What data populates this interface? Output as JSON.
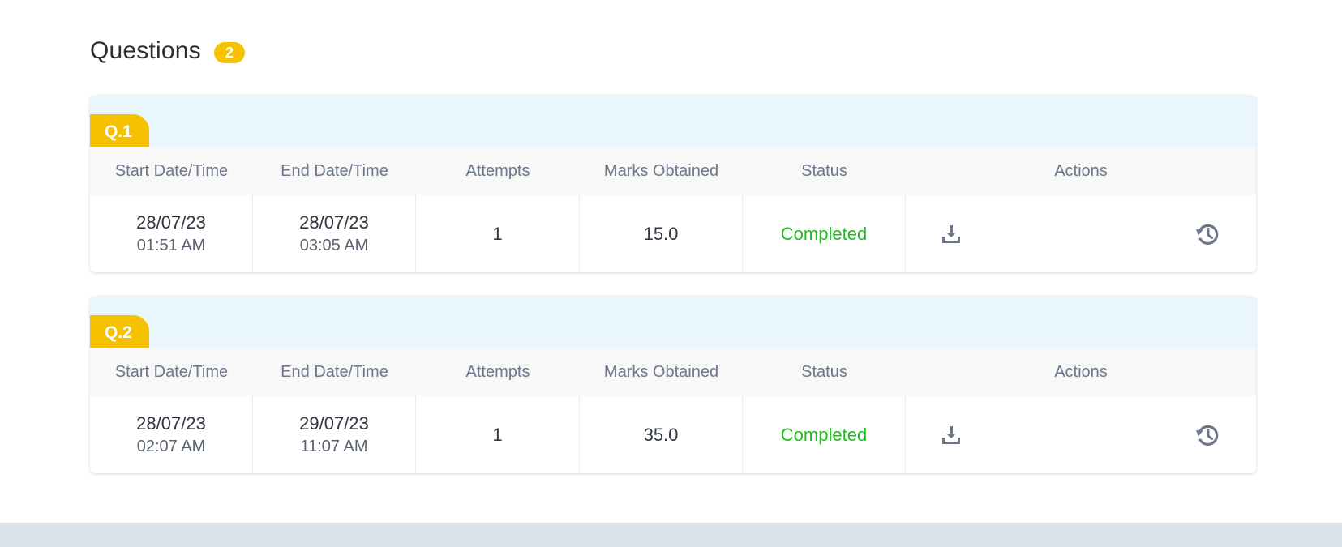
{
  "header": {
    "title": "Questions",
    "count": "2"
  },
  "columns": {
    "start": "Start Date/Time",
    "end": "End Date/Time",
    "attempts": "Attempts",
    "marks": "Marks Obtained",
    "status": "Status",
    "actions": "Actions"
  },
  "questions": [
    {
      "tag": "Q.1",
      "start_date": "28/07/23",
      "start_time": "01:51 AM",
      "end_date": "28/07/23",
      "end_time": "03:05 AM",
      "attempts": "1",
      "marks": "15.0",
      "status": "Completed"
    },
    {
      "tag": "Q.2",
      "start_date": "28/07/23",
      "start_time": "02:07 AM",
      "end_date": "29/07/23",
      "end_time": "11:07 AM",
      "attempts": "1",
      "marks": "35.0",
      "status": "Completed"
    }
  ],
  "icons": {
    "download": "download-icon",
    "history": "history-icon"
  },
  "colors": {
    "badge": "#f6c200",
    "card_header": "#e9f6fc",
    "status_completed": "#1dbd1d",
    "icon": "#6b778c",
    "bottom_bar": "#dde3ea"
  }
}
